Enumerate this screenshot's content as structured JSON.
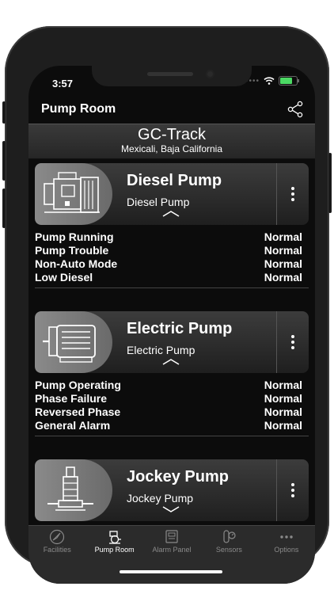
{
  "status": {
    "time": "3:57"
  },
  "nav": {
    "title": "Pump Room"
  },
  "facility": {
    "name": "GC-Track",
    "location": "Mexicali, Baja California"
  },
  "cards": [
    {
      "title": "Diesel Pump",
      "subtitle": "Diesel Pump",
      "image_icon": "diesel-engine-icon",
      "expanded": true,
      "alarms": [
        {
          "label": "Pump Running",
          "value": "Normal"
        },
        {
          "label": "Pump Trouble",
          "value": "Normal"
        },
        {
          "label": "Non-Auto Mode",
          "value": "Normal"
        },
        {
          "label": "Low Diesel",
          "value": "Normal"
        }
      ]
    },
    {
      "title": "Electric Pump",
      "subtitle": "Electric Pump",
      "image_icon": "electric-motor-icon",
      "expanded": true,
      "alarms": [
        {
          "label": "Pump Operating",
          "value": "Normal"
        },
        {
          "label": "Phase Failure",
          "value": "Normal"
        },
        {
          "label": "Reversed Phase",
          "value": "Normal"
        },
        {
          "label": "General Alarm",
          "value": "Normal"
        }
      ]
    },
    {
      "title": "Jockey Pump",
      "subtitle": "Jockey Pump",
      "image_icon": "jockey-pump-icon",
      "expanded": false
    }
  ],
  "tabs": [
    {
      "label": "Facilities",
      "icon": "compass-icon",
      "active": false
    },
    {
      "label": "Pump Room",
      "icon": "pump-room-icon",
      "active": true
    },
    {
      "label": "Alarm Panel",
      "icon": "alarm-panel-icon",
      "active": false
    },
    {
      "label": "Sensors",
      "icon": "sensors-icon",
      "active": false
    },
    {
      "label": "Options",
      "icon": "more-icon",
      "active": false
    }
  ],
  "colors": {
    "background": "#0c0c0c",
    "card": "#2e2e2e",
    "text": "#ffffff",
    "tab_inactive": "#8a8a8a"
  }
}
